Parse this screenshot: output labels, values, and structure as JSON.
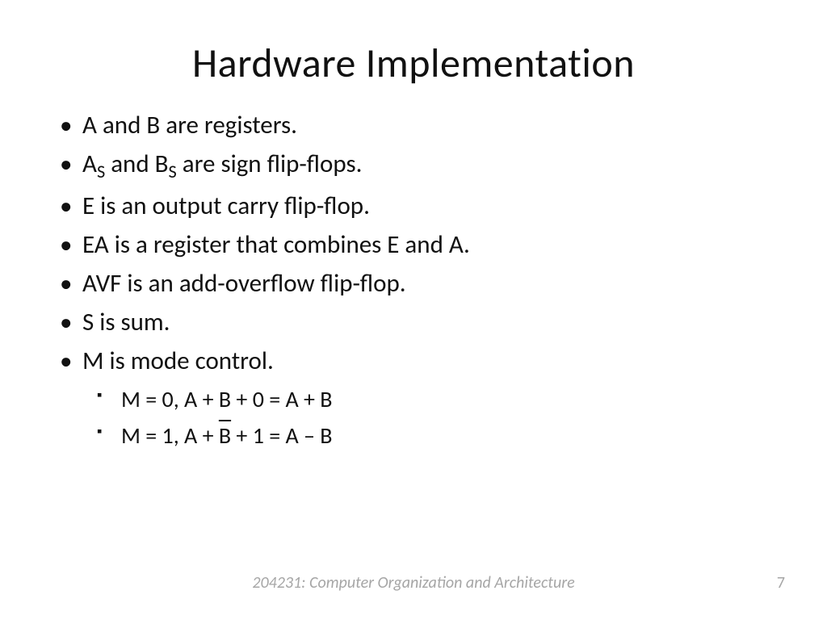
{
  "title": "Hardware Implementation",
  "bullets": {
    "b1": "A and B are registers.",
    "b2_pre": "A",
    "b2_sub1": "S",
    "b2_mid": " and B",
    "b2_sub2": "S",
    "b2_post": " are sign flip-flops.",
    "b3": "E is an output carry flip-flop.",
    "b4": "EA is a register that combines E and A.",
    "b5": "AVF is an add-overflow flip-flop.",
    "b6": "S is sum.",
    "b7": "M is mode control.",
    "s1": "M = 0, A + B + 0 = A + B",
    "s2_pre": "M = 1, A + ",
    "s2_bar": "B",
    "s2_post": " + 1 = A – B"
  },
  "footer": "204231: Computer Organization and Architecture",
  "page": "7"
}
